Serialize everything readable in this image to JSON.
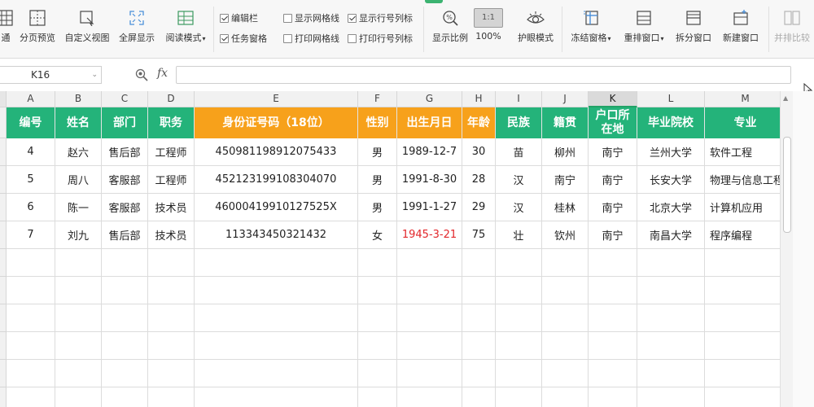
{
  "ribbon": {
    "tab_partial": "通",
    "buttons": [
      {
        "label": "分页预览"
      },
      {
        "label": "自定义视图"
      },
      {
        "label": "全屏显示"
      },
      {
        "label": "阅读模式"
      }
    ],
    "checkboxes": [
      {
        "label": "编辑栏",
        "checked": true
      },
      {
        "label": "任务窗格",
        "checked": true
      },
      {
        "label": "显示网格线",
        "checked": false
      },
      {
        "label": "打印网格线",
        "checked": false
      },
      {
        "label": "显示行号列标",
        "checked": true
      },
      {
        "label": "打印行号列标",
        "checked": false
      }
    ],
    "zoom": {
      "label": "显示比例",
      "pct_label": "100%",
      "pct_icon": "1:1"
    },
    "eye_protect": "护眼模式",
    "window_buttons": [
      {
        "label": "冻结窗格"
      },
      {
        "label": "重排窗口"
      },
      {
        "label": "拆分窗口"
      },
      {
        "label": "新建窗口"
      },
      {
        "label": "并排比较"
      }
    ]
  },
  "formula_bar": {
    "name_box": "K16",
    "fx_label": "fx",
    "value": ""
  },
  "sheet": {
    "columns": [
      "A",
      "B",
      "C",
      "D",
      "E",
      "F",
      "G",
      "H",
      "I",
      "J",
      "K",
      "L",
      "M"
    ],
    "selected_column": "K",
    "header": [
      "编号",
      "姓名",
      "部门",
      "职务",
      "身份证号码（18位）",
      "性别",
      "出生月日",
      "年龄",
      "民族",
      "籍贯",
      "户口所在地",
      "毕业院校",
      "专业"
    ],
    "rows": [
      [
        "4",
        "赵六",
        "售后部",
        "工程师",
        "450981198912075433",
        "男",
        "1989-12-7",
        "30",
        "苗",
        "柳州",
        "南宁",
        "兰州大学",
        "软件工程"
      ],
      [
        "5",
        "周八",
        "客服部",
        "工程师",
        "452123199108304070",
        "男",
        "1991-8-30",
        "28",
        "汉",
        "南宁",
        "南宁",
        "长安大学",
        "物理与信息工程"
      ],
      [
        "6",
        "陈一",
        "客服部",
        "技术员",
        "46000419910127525X",
        "男",
        "1991-1-27",
        "29",
        "汉",
        "桂林",
        "南宁",
        "北京大学",
        "计算机应用"
      ],
      [
        "7",
        "刘九",
        "售后部",
        "技术员",
        "113343450321432",
        "女",
        "1945-3-21",
        "75",
        "壮",
        "钦州",
        "南宁",
        "南昌大学",
        "程序编程"
      ]
    ],
    "highlight_color": "#e2262a",
    "header_green": "#24b37a",
    "header_orange": "#f7a11b"
  }
}
